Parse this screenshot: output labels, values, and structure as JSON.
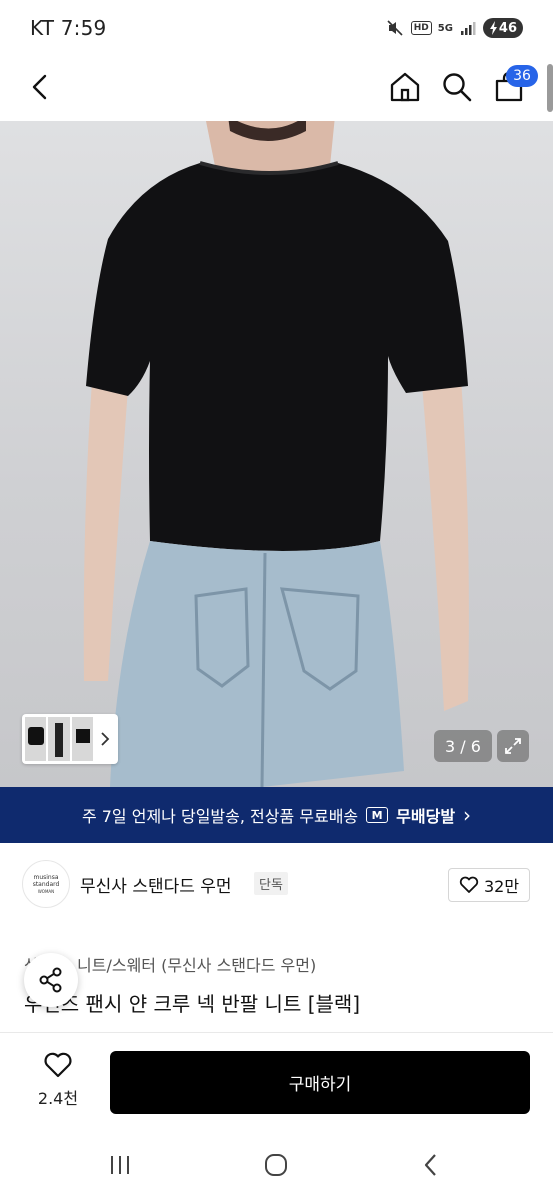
{
  "status_bar": {
    "carrier_time": "KT 7:59",
    "icons": [
      "mute-icon",
      "hd-icon",
      "5g-icon",
      "signal-icon"
    ],
    "network": "HD",
    "mobile": "5G",
    "battery": "46"
  },
  "header": {
    "icons": [
      "back-arrow-icon",
      "home-icon",
      "search-icon",
      "cart-icon"
    ],
    "cart_count": "36"
  },
  "gallery": {
    "page_indicator": "3 / 6",
    "expand_icon": "expand-icon",
    "thumb_next_icon": "chevron-right-icon"
  },
  "shipping_banner": {
    "text": "주 7일 언제나 당일발송, 전상품 무료배송",
    "logo_letter": "M",
    "free_label": "무배당발",
    "chevron": "›"
  },
  "brand": {
    "logo_text_line1": "musinsa",
    "logo_text_line2": "standard",
    "logo_text_line3": "WOMAN",
    "name": "무신사 스탠다드 우먼",
    "badge": "단독",
    "like_count": "32만"
  },
  "product": {
    "category": "상의 > 니트/스웨터 (무신사 스탠다드 우먼)",
    "title": "우먼즈 팬시 얀 크루 넥 반팔 니트 [블랙]"
  },
  "bottom_bar": {
    "wish_count": "2.4천",
    "buy_label": "구매하기"
  },
  "colors": {
    "banner_bg": "#0f2a6e",
    "badge_blue": "#2764e8",
    "buy_bg": "#000000"
  }
}
